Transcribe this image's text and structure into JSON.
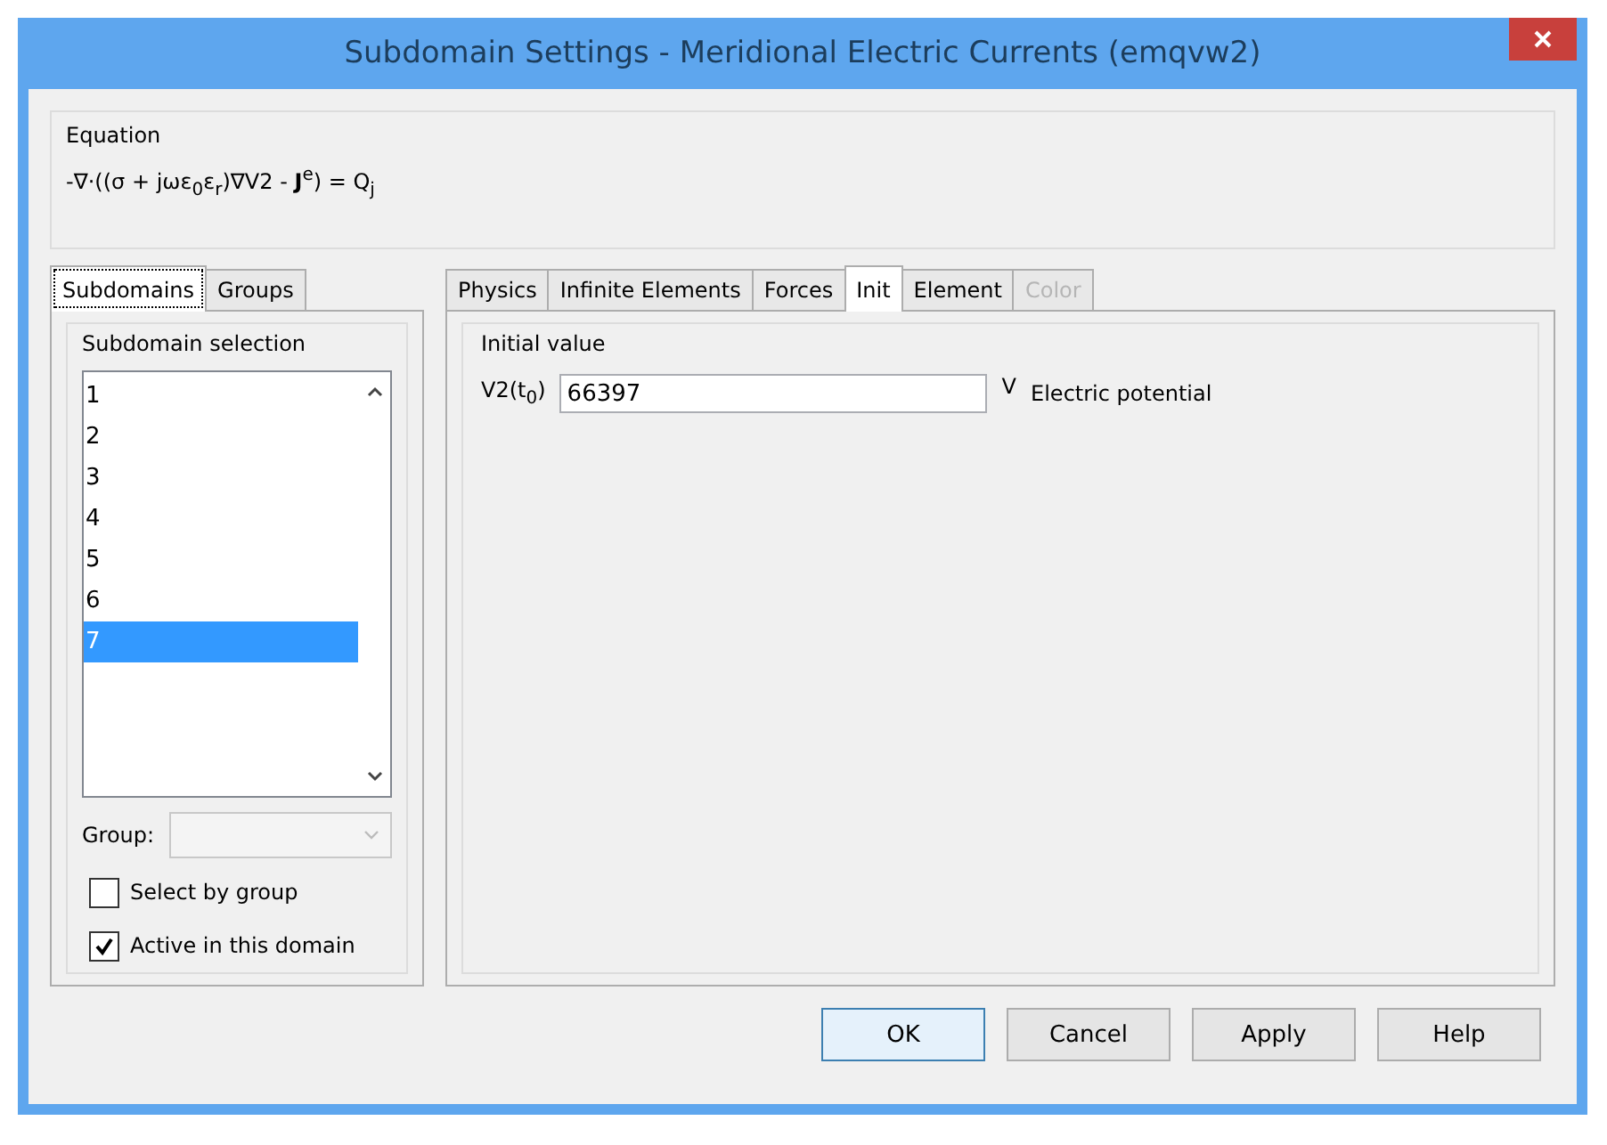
{
  "window": {
    "title": "Subdomain Settings - Meridional Electric Currents (emqvw2)"
  },
  "equation": {
    "label": "Equation",
    "formula": "-∇·((σ + jωε$_{0}$ε$_{r}$)∇V2 - **J**$^{e}$) = Q$_{j}$"
  },
  "left_tabs": [
    {
      "label": "Subdomains",
      "selected": true
    },
    {
      "label": "Groups",
      "selected": false
    }
  ],
  "subdomain_selection": {
    "label": "Subdomain selection",
    "items": [
      {
        "label": "1",
        "selected": false
      },
      {
        "label": "2",
        "selected": false
      },
      {
        "label": "3",
        "selected": false
      },
      {
        "label": "4",
        "selected": false
      },
      {
        "label": "5",
        "selected": false
      },
      {
        "label": "6",
        "selected": false
      },
      {
        "label": "7",
        "selected": true
      }
    ],
    "group_label": "Group:",
    "group_disabled": true
  },
  "checkboxes": [
    {
      "label": "Select by group",
      "checked": false
    },
    {
      "label": "Active in this domain",
      "checked": true
    }
  ],
  "tabs": [
    {
      "label": "Physics",
      "selected": false,
      "disabled": false
    },
    {
      "label": "Infinite Elements",
      "selected": false,
      "disabled": false
    },
    {
      "label": "Forces",
      "selected": false,
      "disabled": false
    },
    {
      "label": "Init",
      "selected": true,
      "disabled": false
    },
    {
      "label": "Element",
      "selected": false,
      "disabled": false
    },
    {
      "label": "Color",
      "selected": false,
      "disabled": true
    }
  ],
  "initial_value": {
    "label": "Initial value",
    "variable": "V2(t$_{0}$)",
    "value": "66397",
    "unit": "V",
    "description": "Electric potential"
  },
  "buttons": [
    {
      "label": "OK",
      "default": true
    },
    {
      "label": "Cancel",
      "default": false
    },
    {
      "label": "Apply",
      "default": false
    },
    {
      "label": "Help",
      "default": false
    }
  ]
}
